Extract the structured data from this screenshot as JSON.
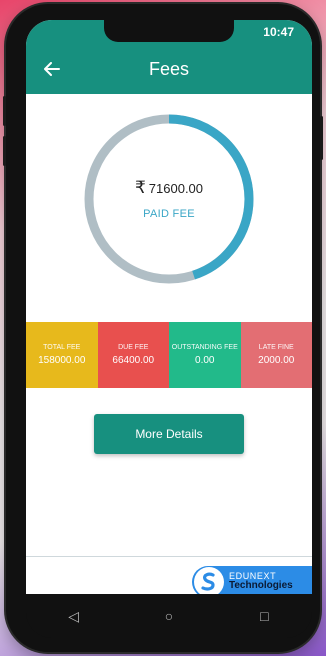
{
  "status_bar": {
    "time": "10:47"
  },
  "app_bar": {
    "title": "Fees",
    "back_icon": "arrow-left-icon"
  },
  "summary": {
    "currency_symbol": "₹",
    "paid_amount": "71600.00",
    "paid_label": "PAID FEE",
    "paid_fraction": 0.45,
    "colors": {
      "paid": "#3aa6c6",
      "remaining": "#b0bec5"
    }
  },
  "fee_tiles": [
    {
      "label": "TOTAL FEE",
      "value": "158000.00",
      "color": "#e7b91c"
    },
    {
      "label": "DUE FEE",
      "value": "66400.00",
      "color": "#e8504e"
    },
    {
      "label": "OUTSTANDING FEE",
      "value": "0.00",
      "color": "#22ba8a"
    },
    {
      "label": "LATE FINE",
      "value": "2000.00",
      "color": "#e36e73"
    }
  ],
  "more_details_label": "More Details",
  "brand": {
    "line1": "EDUNEXT",
    "line2": "Technologies"
  },
  "nav": {
    "back_glyph": "◁",
    "home_glyph": "○",
    "recents_glyph": "□"
  },
  "accent_color": "#17907f"
}
